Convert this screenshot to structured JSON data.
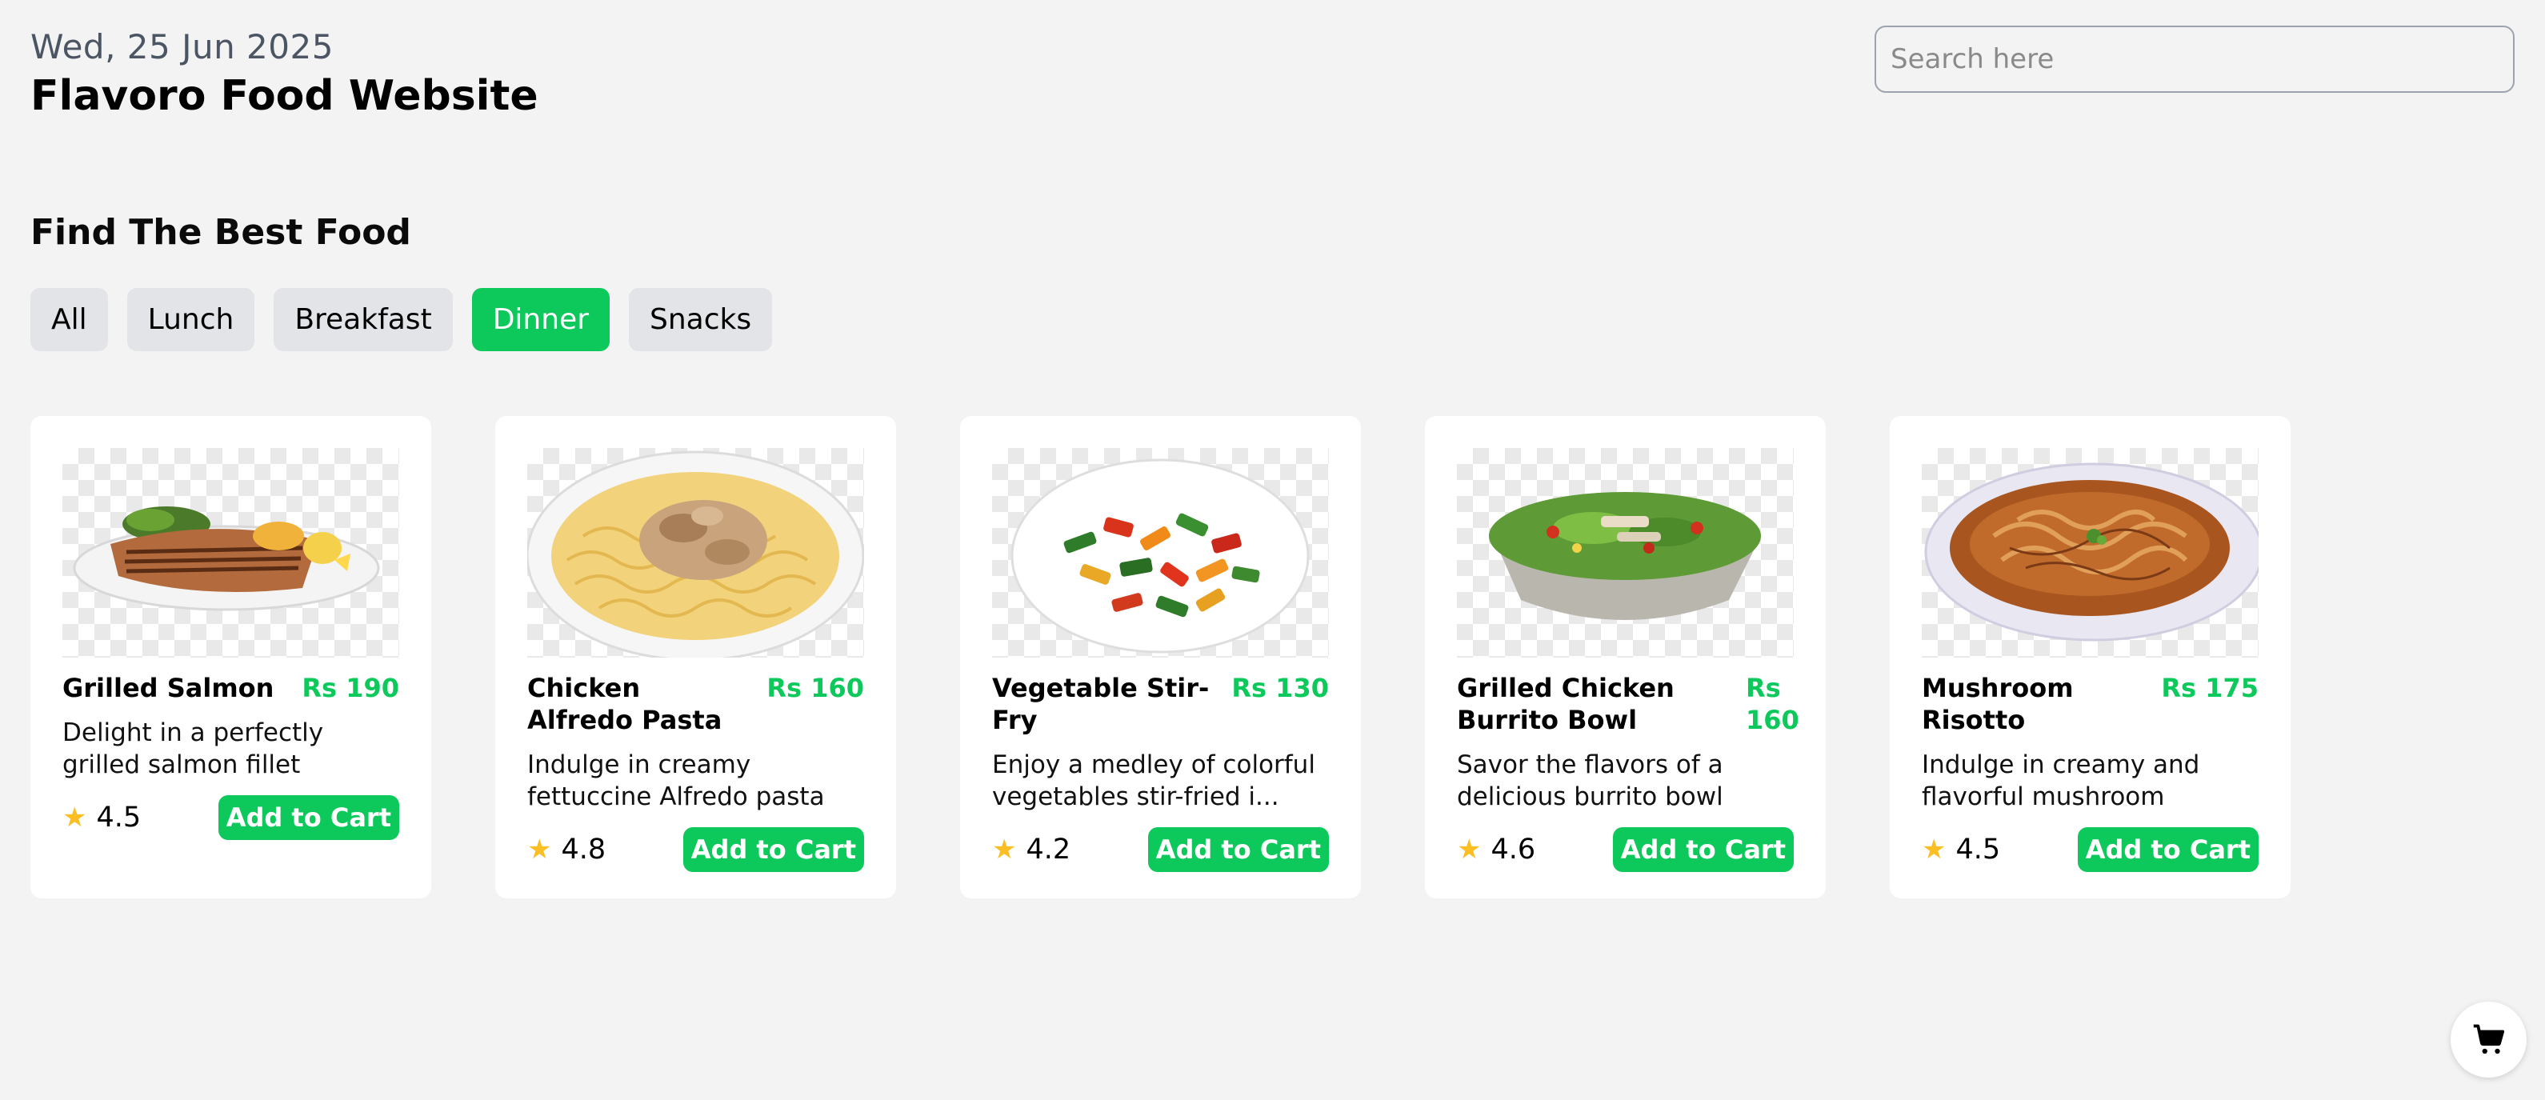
{
  "header": {
    "date": "Wed, 25 Jun 2025",
    "title": "Flavoro Food Website"
  },
  "search": {
    "placeholder": "Search here",
    "value": ""
  },
  "section_title": "Find The Best Food",
  "filters": [
    {
      "label": "All",
      "active": false
    },
    {
      "label": "Lunch",
      "active": false
    },
    {
      "label": "Breakfast",
      "active": false
    },
    {
      "label": "Dinner",
      "active": true
    },
    {
      "label": "Snacks",
      "active": false
    }
  ],
  "cards": [
    {
      "name": "Grilled Salmon",
      "price": "Rs 190",
      "description": "Delight in a perfectly grilled salmon fillet seaso...",
      "rating": "4.5",
      "button": "Add to Cart",
      "image_icon": "grilled-salmon-image"
    },
    {
      "name": "Chicken Alfredo Pasta",
      "price": "Rs 160",
      "description": "Indulge in creamy fettuccine Alfredo pasta with te...",
      "rating": "4.8",
      "button": "Add to Cart",
      "image_icon": "alfredo-pasta-image"
    },
    {
      "name": "Vegetable Stir-Fry",
      "price": "Rs 130",
      "description": "Enjoy a medley of colorful vegetables stir-fried i...",
      "rating": "4.2",
      "button": "Add to Cart",
      "image_icon": "stir-fry-image"
    },
    {
      "name": "Grilled Chicken Burrito Bowl",
      "price": "Rs 160",
      "description": "Savor the flavors of a delicious burrito bowl with...",
      "rating": "4.6",
      "button": "Add to Cart",
      "image_icon": "burrito-bowl-image"
    },
    {
      "name": "Mushroom Risotto",
      "price": "Rs 175",
      "description": "Indulge in creamy and flavorful mushroom risotto, ...",
      "rating": "4.5",
      "button": "Add to Cart",
      "image_icon": "mushroom-risotto-image"
    }
  ],
  "colors": {
    "accent": "#0dc95c",
    "star": "#fbbf24",
    "background": "#f3f3f3"
  },
  "floating_cart": {
    "icon": "cart-icon"
  }
}
